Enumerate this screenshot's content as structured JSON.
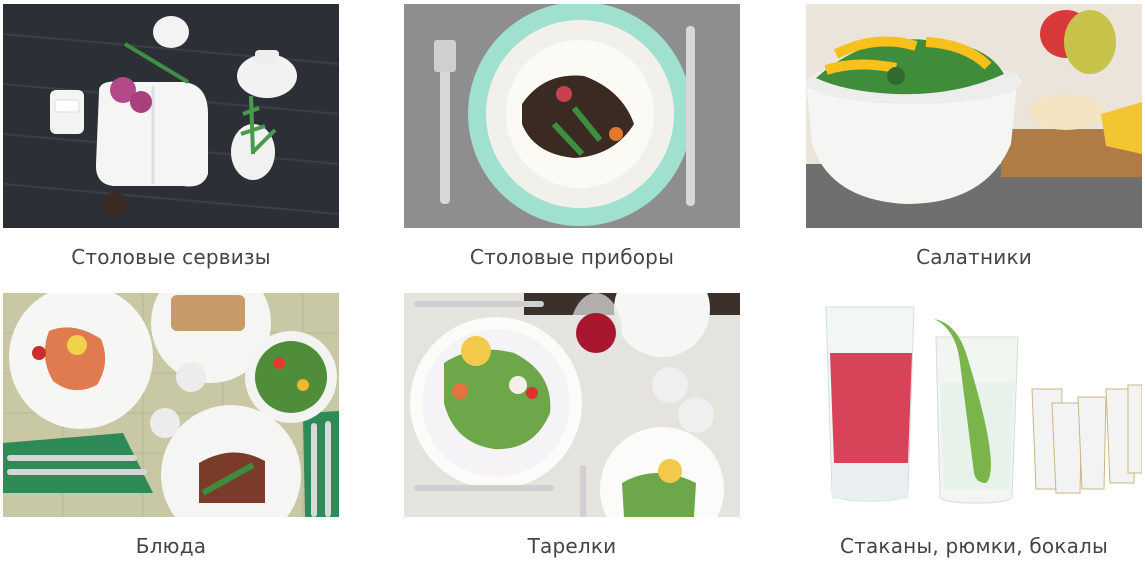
{
  "categories": [
    {
      "label": "Столовые сервизы",
      "image": "dinnerware-sets-photo"
    },
    {
      "label": "Столовые приборы",
      "image": "cutlery-photo"
    },
    {
      "label": "Салатники",
      "image": "salad-bowls-photo"
    },
    {
      "label": "Блюда",
      "image": "serving-platters-photo"
    },
    {
      "label": "Тарелки",
      "image": "plates-photo"
    },
    {
      "label": "Стаканы, рюмки, бокалы",
      "image": "glassware-photo"
    }
  ],
  "colors": {
    "caption": "#444444",
    "dark_wood": "#2b2e33",
    "mint": "#9fe0cf",
    "green_cloth": "#2e8a57",
    "red_drink": "#d4233d"
  }
}
